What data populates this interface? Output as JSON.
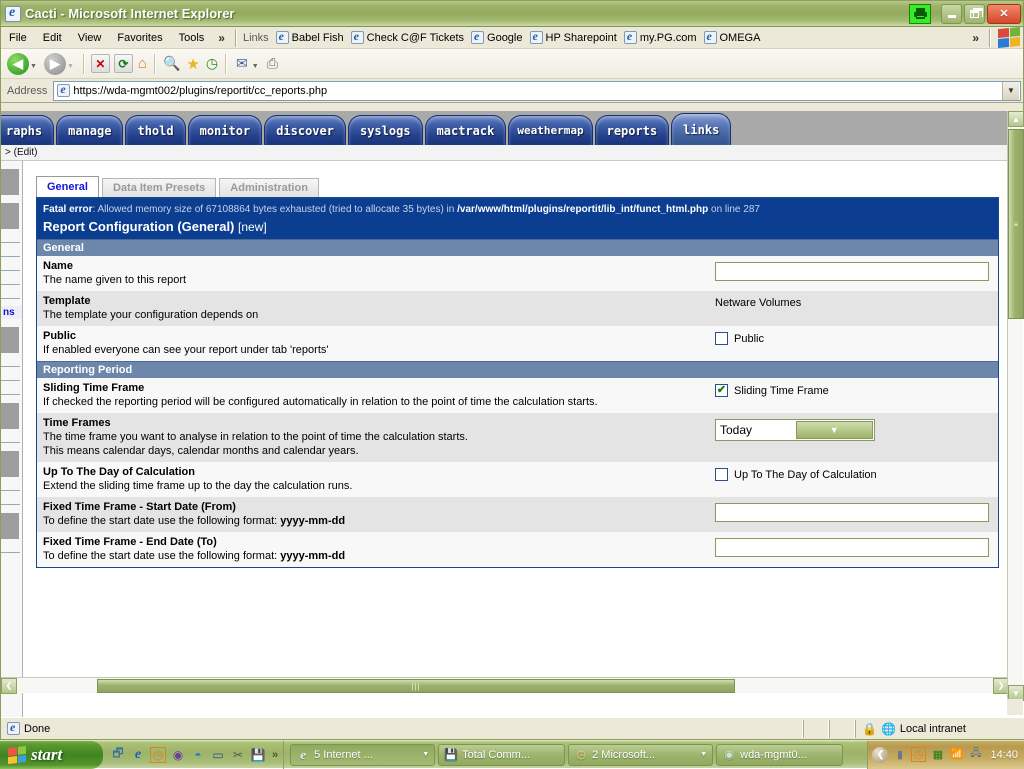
{
  "window": {
    "title": "Cacti - Microsoft Internet Explorer",
    "app_icon": "ie-page-icon",
    "print_icon": "printer-icon",
    "minimize_label": "",
    "restore_label": "",
    "close_label": "✕"
  },
  "menubar": {
    "items": [
      "File",
      "Edit",
      "View",
      "Favorites",
      "Tools"
    ],
    "overflow": "»",
    "links_label": "Links",
    "links": [
      {
        "label": "Babel Fish",
        "icon": "ie-link-icon"
      },
      {
        "label": "Check C@F Tickets",
        "icon": "ie-link-icon"
      },
      {
        "label": "Google",
        "icon": "ie-link-icon"
      },
      {
        "label": "HP Sharepoint",
        "icon": "ie-link-icon"
      },
      {
        "label": "my.PG.com",
        "icon": "ie-link-icon"
      },
      {
        "label": "OMEGA",
        "icon": "ie-link-icon"
      }
    ],
    "right_overflow": "»"
  },
  "toolbar": {
    "back": "◀",
    "forward": "▶",
    "stop": "✕",
    "refresh": "⟳",
    "home": "⌂",
    "search": "🔍",
    "favorites": "★",
    "history": "◷",
    "mail": "✉",
    "print": "⎙",
    "dropdown_caret": "▼"
  },
  "address": {
    "label": "Address",
    "url": "https://wda-mgmt002/plugins/reportit/cc_reports.php",
    "icon": "ie-page-icon",
    "dropdown_caret": "▼"
  },
  "cacti": {
    "tabs": [
      {
        "label": "raphs",
        "active": false
      },
      {
        "label": "manage",
        "active": false
      },
      {
        "label": "thold",
        "active": false
      },
      {
        "label": "monitor",
        "active": false
      },
      {
        "label": "discover",
        "active": false
      },
      {
        "label": "syslogs",
        "active": false
      },
      {
        "label": "mactrack",
        "active": false
      },
      {
        "label": "weathermap",
        "active": false
      },
      {
        "label": "reports",
        "active": false
      },
      {
        "label": "links",
        "active": true
      }
    ],
    "breadcrumb": "> (Edit)",
    "sidebar_fragment_label": "ns"
  },
  "subtabs": [
    {
      "label": "General",
      "active": true
    },
    {
      "label": "Data Item Presets",
      "active": false
    },
    {
      "label": "Administration",
      "active": false
    }
  ],
  "error": {
    "prefix": "Fatal error",
    "message": ": Allowed memory size of 67108864 bytes exhausted (tried to allocate 35 bytes) in ",
    "path": "/var/www/html/plugins/reportit/lib_int/funct_html.php",
    "suffix": " on line 287"
  },
  "panel": {
    "title": "Report Configuration (General)",
    "title_suffix": "[new]"
  },
  "sections": {
    "general": {
      "header": "General",
      "rows": [
        {
          "label": "Name",
          "desc": "The name given to this report",
          "control": "text",
          "value": ""
        },
        {
          "label": "Template",
          "desc": "The template your configuration depends on",
          "control": "static",
          "value": "Netware Volumes"
        },
        {
          "label": "Public",
          "desc": "If enabled everyone can see your report under tab 'reports'",
          "control": "checkbox",
          "checkbox_label": "Public",
          "checked": false
        }
      ]
    },
    "reporting_period": {
      "header": "Reporting Period",
      "rows": [
        {
          "label": "Sliding Time Frame",
          "desc": "If checked the reporting period will be configured automatically in relation to the point of time the calculation starts.",
          "control": "checkbox",
          "checkbox_label": "Sliding Time Frame",
          "checked": true,
          "check_glyph": "✔"
        },
        {
          "label": "Time Frames",
          "desc": "The time frame you want to analyse in relation to the point of time the calculation starts.",
          "desc2": "This means calendar days, calendar months and calendar years.",
          "control": "select",
          "value": "Today",
          "caret": "▼"
        },
        {
          "label": "Up To The Day of Calculation",
          "desc": "Extend the sliding time frame up to the day the calculation runs.",
          "control": "checkbox",
          "checkbox_label": "Up To The Day of Calculation",
          "checked": false
        },
        {
          "label": "Fixed Time Frame - Start Date (From)",
          "desc": "To define the start date use the following format: ",
          "desc_bold": "yyyy-mm-dd",
          "control": "text",
          "value": ""
        },
        {
          "label": "Fixed Time Frame - End Date (To)",
          "desc": "To define the start date use the following format: ",
          "desc_bold": "yyyy-mm-dd",
          "control": "text",
          "value": ""
        }
      ]
    }
  },
  "scrollbars": {
    "v_up": "▲",
    "v_down": "▼",
    "v_grip": "≡",
    "h_left": "❮",
    "h_right": "❯",
    "h_grip": "|||"
  },
  "statusbar": {
    "text": "Done",
    "icon": "ie-page-icon",
    "lock_icon": "lock-icon",
    "zone_icon": "globe-icon",
    "zone": "Local intranet"
  },
  "taskbar": {
    "start_label": "start",
    "quicklaunch": [
      {
        "name": "show-desktop-icon",
        "glyph": "🗗"
      },
      {
        "name": "internet-explorer-icon",
        "glyph": "e"
      },
      {
        "name": "clock-icon",
        "glyph": "◷"
      },
      {
        "name": "netscape-icon",
        "glyph": "◉"
      },
      {
        "name": "media-icon",
        "glyph": "◓"
      },
      {
        "name": "window-icon",
        "glyph": "▭"
      },
      {
        "name": "tools-icon",
        "glyph": "✂"
      },
      {
        "name": "save-icon",
        "glyph": "💾"
      }
    ],
    "quicklaunch_overflow": "»",
    "tasks": [
      {
        "label": "5 Internet ...",
        "icon": "internet-explorer-icon",
        "glyph": "e",
        "caret": "▼",
        "pressed": true
      },
      {
        "label": "Total Comm...",
        "icon": "floppy-icon",
        "glyph": "💾",
        "caret": "",
        "pressed": false
      },
      {
        "label": "2 Microsoft...",
        "icon": "outlook-clock-icon",
        "glyph": "◷",
        "caret": "▼",
        "pressed": false
      },
      {
        "label": "wda-mgmt0...",
        "icon": "remote-desktop-icon",
        "glyph": "◉",
        "caret": "",
        "pressed": false
      }
    ],
    "tray": {
      "expand": "❮",
      "icons": [
        {
          "name": "battery-icon",
          "glyph": "▮"
        },
        {
          "name": "clock-tray-icon",
          "glyph": "◷"
        },
        {
          "name": "grid-icon",
          "glyph": "▦"
        },
        {
          "name": "network-signal-icon",
          "glyph": "📶"
        },
        {
          "name": "network-adapter-icon",
          "glyph": "🖧"
        }
      ],
      "clock": "14:40"
    }
  }
}
